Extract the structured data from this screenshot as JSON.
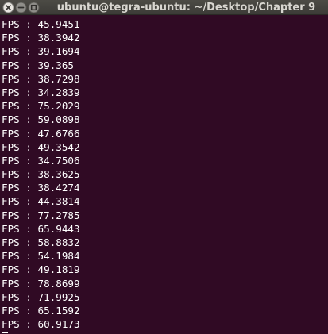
{
  "window": {
    "title": "ubuntu@tegra-ubuntu: ~/Desktop/Chapter 9",
    "controls": {
      "close_icon": "close-icon",
      "minimize_icon": "minimize-icon",
      "maximize_icon": "maximize-icon"
    }
  },
  "terminal": {
    "lines": [
      "FPS : 45.9451",
      "FPS : 38.3942",
      "FPS : 39.1694",
      "FPS : 39.365",
      "FPS : 38.7298",
      "FPS : 34.2839",
      "FPS : 75.2029",
      "FPS : 59.0898",
      "FPS : 47.6766",
      "FPS : 49.3542",
      "FPS : 34.7506",
      "FPS : 38.3625",
      "FPS : 38.4274",
      "FPS : 44.3814",
      "FPS : 77.2785",
      "FPS : 65.9443",
      "FPS : 58.8832",
      "FPS : 54.1984",
      "FPS : 49.1819",
      "FPS : 78.8699",
      "FPS : 71.9925",
      "FPS : 65.1592",
      "FPS : 60.9173"
    ]
  },
  "colors": {
    "terminal_background": "#300a24",
    "terminal_text": "#ffffff",
    "titlebar": "#3c3b37",
    "title_text": "#d8d6d0"
  }
}
